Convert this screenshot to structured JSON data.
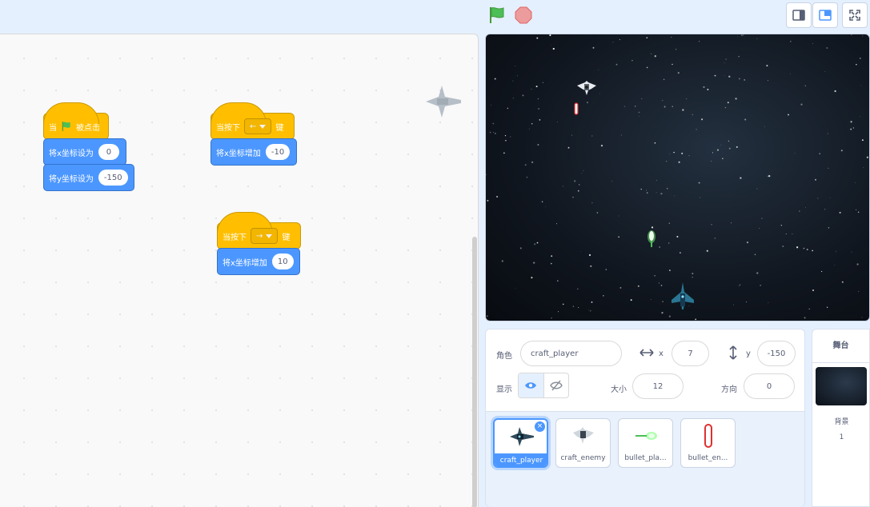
{
  "toolbar": {
    "green_flag_icon": "green-flag-icon",
    "stop_icon": "stop-icon",
    "layout_small_icon": "small-stage-icon",
    "layout_normal_icon": "normal-stage-icon",
    "fullscreen_icon": "fullscreen-icon"
  },
  "scripts": {
    "s1": {
      "hat_text_a": "当",
      "hat_text_b": "被点击",
      "b1_text": "将x坐标设为",
      "b1_value": "0",
      "b2_text": "将y坐标设为",
      "b2_value": "-150"
    },
    "s2": {
      "hat_text_a": "当按下",
      "key": "←",
      "hat_text_b": "键",
      "b1_text": "将x坐标增加",
      "b1_value": "-10"
    },
    "s3": {
      "hat_text_a": "当按下",
      "key": "→",
      "hat_text_b": "键",
      "b1_text": "将x坐标增加",
      "b1_value": "10"
    }
  },
  "sprite_info": {
    "sprite_label": "角色",
    "sprite_name": "craft_player",
    "x_label": "x",
    "x_value": "7",
    "y_label": "y",
    "y_value": "-150",
    "show_label": "显示",
    "size_label": "大小",
    "size_value": "12",
    "direction_label": "方向",
    "direction_value": "0"
  },
  "sprites": [
    {
      "name": "craft_player",
      "selected": true
    },
    {
      "name": "craft_enemy",
      "selected": false
    },
    {
      "name": "bullet_pla...",
      "selected": false
    },
    {
      "name": "bullet_en...",
      "selected": false
    }
  ],
  "stage_panel": {
    "title": "舞台",
    "backdrop_label": "背景",
    "backdrop_count": "1"
  },
  "colors": {
    "events": "#ffbf00",
    "motion": "#4c97ff",
    "accent": "#4c97ff"
  }
}
